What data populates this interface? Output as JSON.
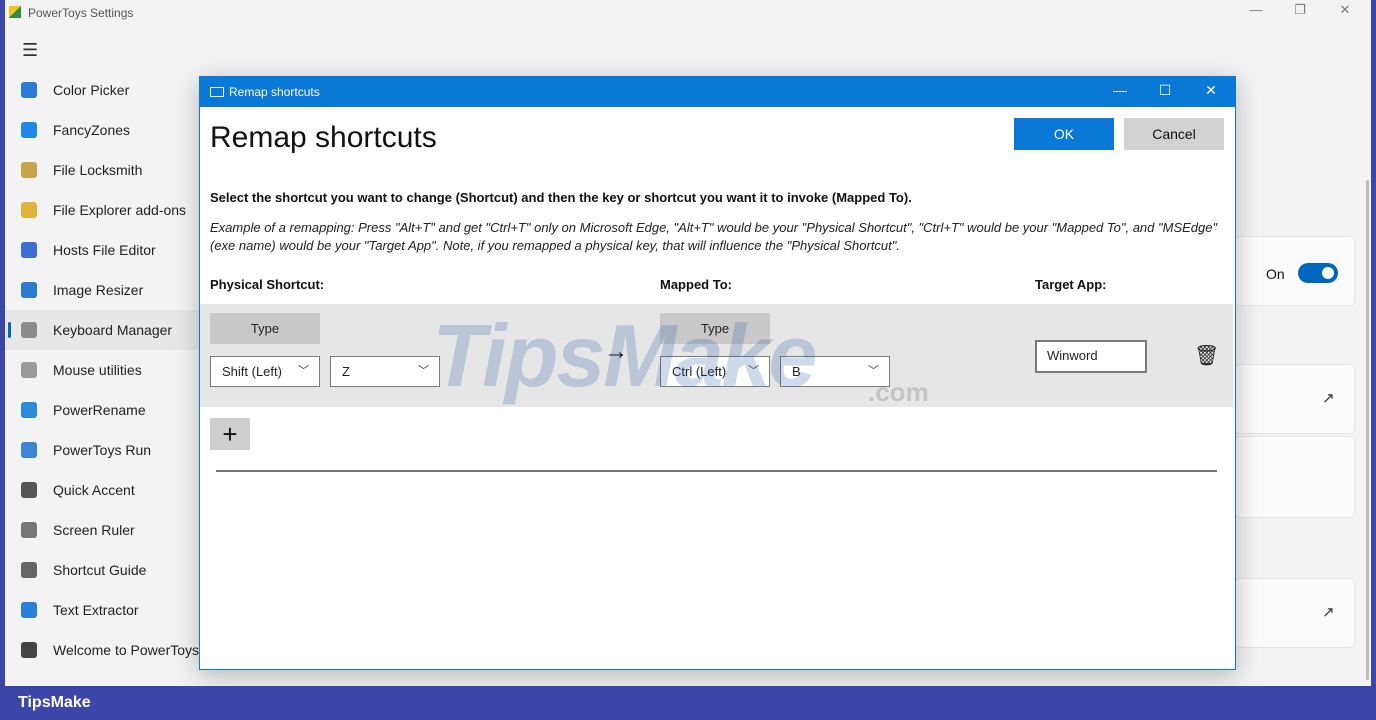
{
  "window": {
    "title": "PowerToys Settings",
    "min": "—",
    "restore": "❐",
    "close": "✕"
  },
  "nav": {
    "items": [
      {
        "label": "Color Picker",
        "color": "#2a7ad6"
      },
      {
        "label": "FancyZones",
        "color": "#1e88e5"
      },
      {
        "label": "File Locksmith",
        "color": "#c9a24a"
      },
      {
        "label": "File Explorer add-ons",
        "color": "#e0b33a"
      },
      {
        "label": "Hosts File Editor",
        "color": "#3c6fd1"
      },
      {
        "label": "Image Resizer",
        "color": "#2b7bd0"
      },
      {
        "label": "Keyboard Manager",
        "color": "#8c8c8c"
      },
      {
        "label": "Mouse utilities",
        "color": "#9a9a9a"
      },
      {
        "label": "PowerRename",
        "color": "#2d8ad8"
      },
      {
        "label": "PowerToys Run",
        "color": "#3a86d4"
      },
      {
        "label": "Quick Accent",
        "color": "#555555"
      },
      {
        "label": "Screen Ruler",
        "color": "#777777"
      },
      {
        "label": "Shortcut Guide",
        "color": "#666666"
      },
      {
        "label": "Text Extractor",
        "color": "#2a7fd6"
      },
      {
        "label": "Welcome to PowerToys",
        "color": "#444444"
      }
    ],
    "selected": "Keyboard Manager"
  },
  "background": {
    "toggle_label": "On",
    "toggle_on": true
  },
  "dialog": {
    "title": "Remap shortcuts",
    "heading": "Remap shortcuts",
    "ok_label": "OK",
    "cancel_label": "Cancel",
    "instruction": "Select the shortcut you want to change (Shortcut) and then the key or shortcut you want it to invoke (Mapped To).",
    "example": "Example of a remapping: Press \"Alt+T\" and get \"Ctrl+T\" only on Microsoft Edge, \"Alt+T\" would be your \"Physical Shortcut\", \"Ctrl+T\" would be your \"Mapped To\", and \"MSEdge\" (exe name) would be your \"Target App\". Note, if you remapped a physical key, that will influence the \"Physical Shortcut\".",
    "col_physical": "Physical Shortcut:",
    "col_mapped": "Mapped To:",
    "col_target": "Target App:",
    "row": {
      "type_label": "Type",
      "physical_key1": "Shift (Left)",
      "physical_key2": "Z",
      "mapped_key1": "Ctrl (Left)",
      "mapped_key2": "B",
      "target_app": "Winword"
    },
    "add_label": "+"
  },
  "watermark": {
    "main": "TipsMake",
    "suffix": ".com"
  },
  "footer": {
    "brand": "TipsMake"
  },
  "colors": {
    "accent": "#0a78d7",
    "frame": "#3a47a8"
  }
}
